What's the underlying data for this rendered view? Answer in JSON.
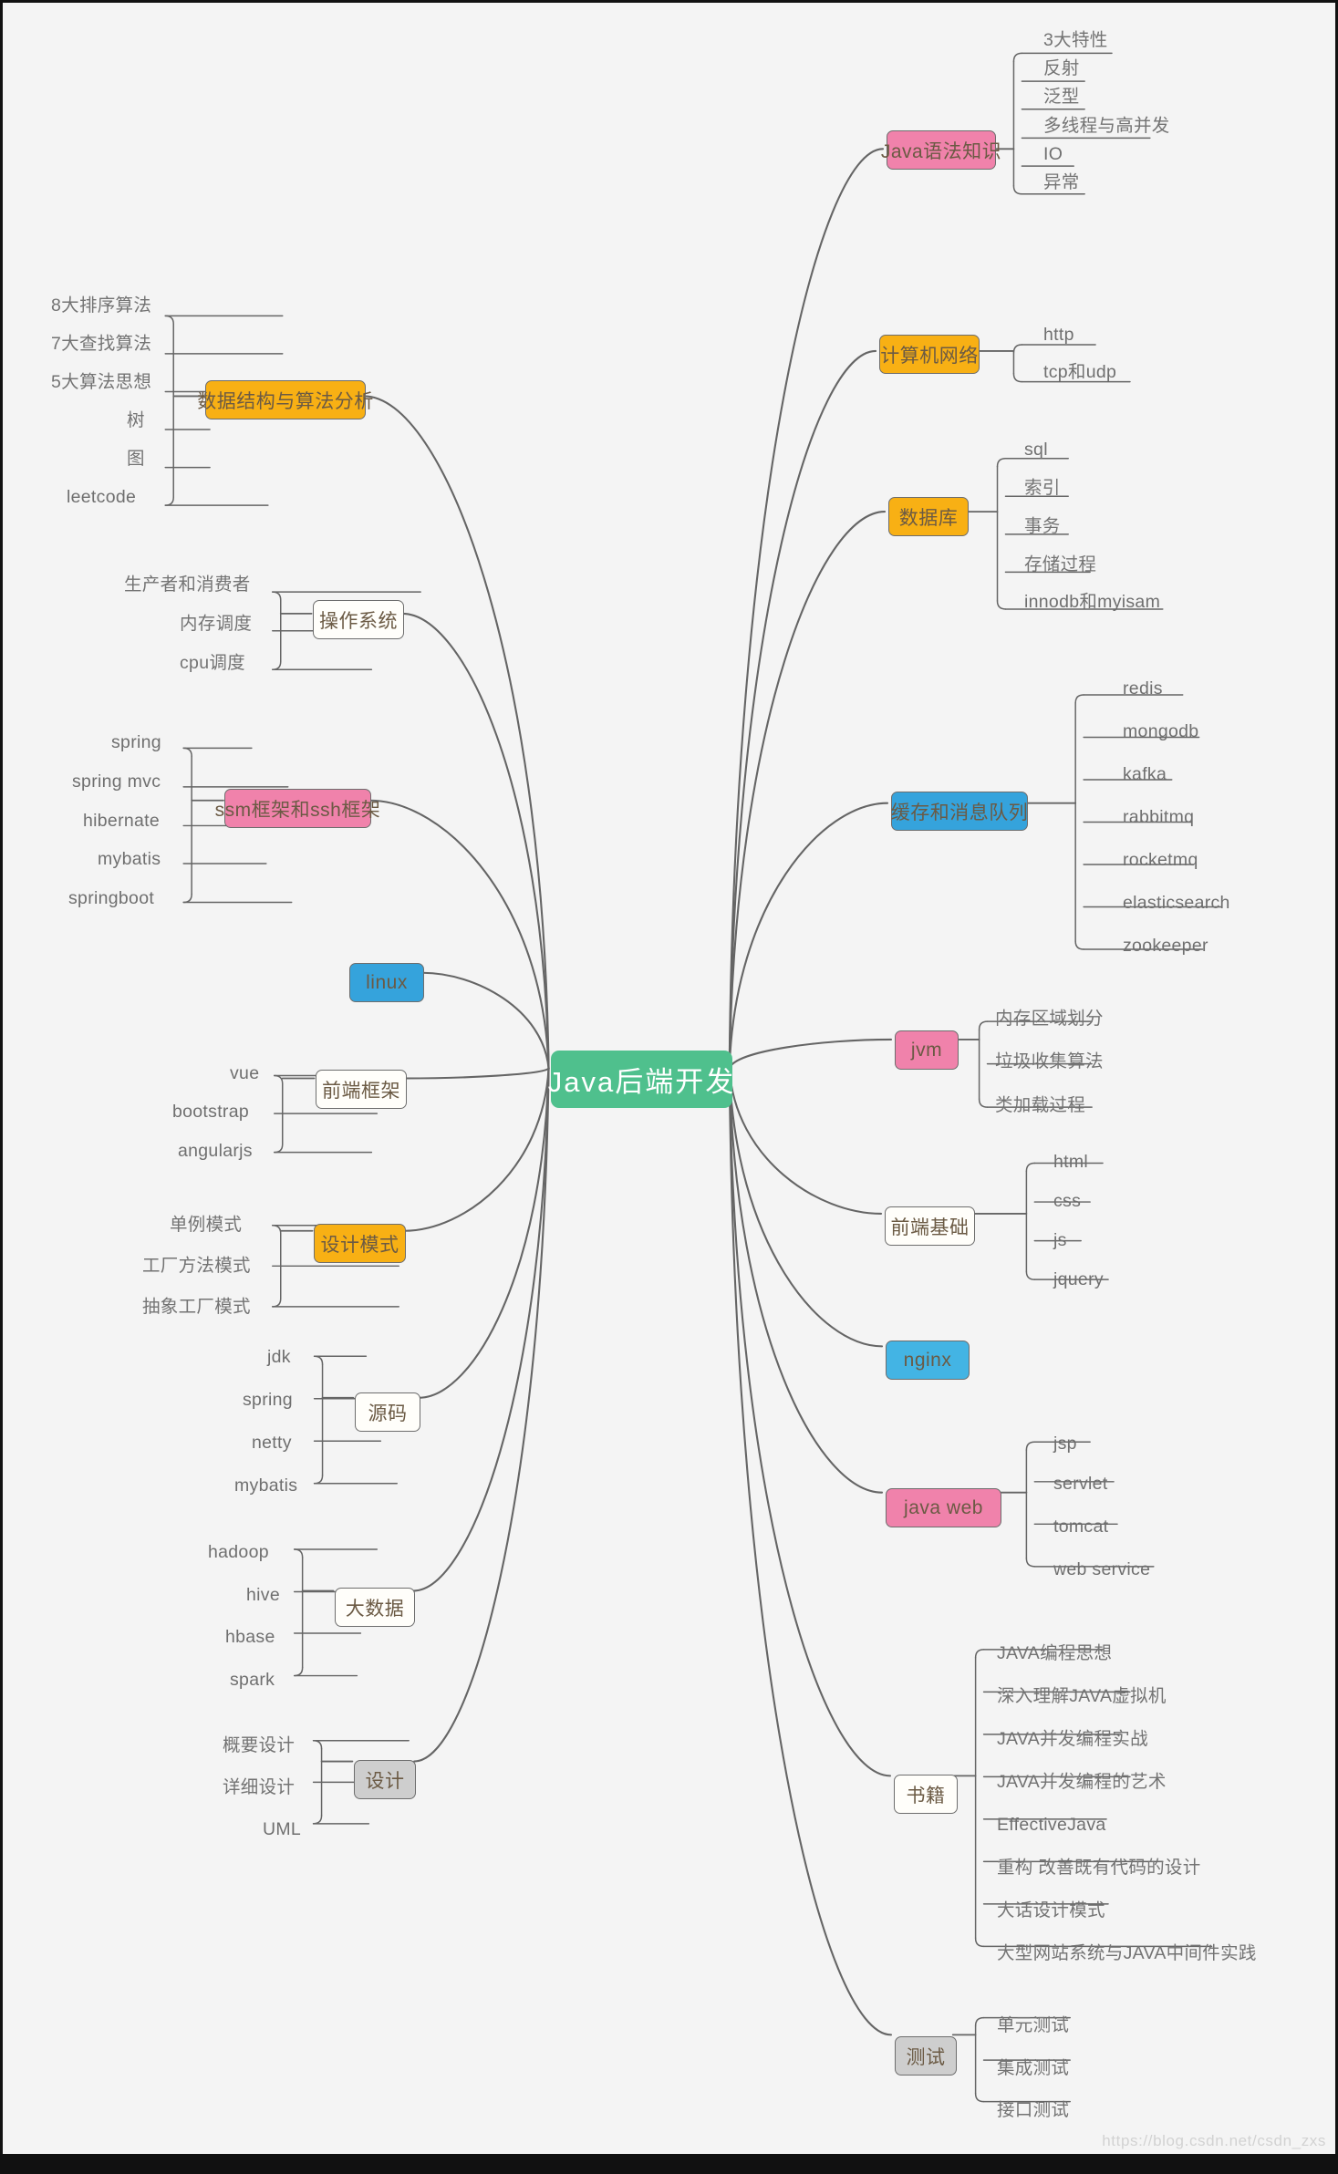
{
  "diagram": {
    "title": "Java后端开发",
    "type": "mindmap",
    "background_color": "#f4f4f4",
    "root_color": "#4fc08d",
    "branch_colors": {
      "pink": "#f082ab",
      "orange": "#f8b014",
      "blue": "#35a3dc",
      "white": "#fffefa",
      "gray": "#cecece"
    },
    "line_color": "#656565",
    "watermark": "https://blog.csdn.net/csdn_zxs"
  },
  "root": {
    "label": "Java后端开发"
  },
  "branches": [
    {
      "id": "java-syntax",
      "label": "Java语法知识",
      "color": "pink",
      "side": "right",
      "children": [
        "3大特性",
        "反射",
        "泛型",
        "多线程与高并发",
        "IO",
        "异常"
      ]
    },
    {
      "id": "computer-network",
      "label": "计算机网络",
      "color": "orange",
      "side": "right",
      "children": [
        "http",
        "tcp和udp"
      ]
    },
    {
      "id": "database",
      "label": "数据库",
      "color": "orange",
      "side": "right",
      "children": [
        "sql",
        "索引",
        "事务",
        "存储过程",
        "innodb和myisam"
      ]
    },
    {
      "id": "cache-mq",
      "label": "缓存和消息队列",
      "color": "blue",
      "side": "right",
      "children": [
        "redis",
        "mongodb",
        "kafka",
        "rabbitmq",
        "rocketmq",
        "elasticsearch",
        "zookeeper"
      ]
    },
    {
      "id": "jvm",
      "label": "jvm",
      "color": "pink",
      "side": "right",
      "children": [
        "内存区域划分",
        "垃圾收集算法",
        "类加载过程"
      ]
    },
    {
      "id": "frontend-basics",
      "label": "前端基础",
      "color": "white",
      "side": "right",
      "children": [
        "html",
        "css",
        "js",
        "jquery"
      ]
    },
    {
      "id": "nginx",
      "label": "nginx",
      "color": "blue",
      "side": "right",
      "children": []
    },
    {
      "id": "java-web",
      "label": "java web",
      "color": "pink",
      "side": "right",
      "children": [
        "jsp",
        "servlet",
        "tomcat",
        "web service"
      ]
    },
    {
      "id": "books",
      "label": "书籍",
      "color": "white",
      "side": "right",
      "children": [
        "JAVA编程思想",
        "深入理解JAVA虚拟机",
        "JAVA并发编程实战",
        "JAVA并发编程的艺术",
        "EffectiveJava",
        "重构 改善既有代码的设计",
        "大话设计模式",
        "大型网站系统与JAVA中间件实践"
      ]
    },
    {
      "id": "testing",
      "label": "测试",
      "color": "gray",
      "side": "right",
      "children": [
        "单元测试",
        "集成测试",
        "接口测试"
      ]
    },
    {
      "id": "data-structure",
      "label": "数据结构与算法分析",
      "color": "orange",
      "side": "left",
      "children": [
        "8大排序算法",
        "7大查找算法",
        "5大算法思想",
        "树",
        "图",
        "leetcode"
      ]
    },
    {
      "id": "operating-system",
      "label": "操作系统",
      "color": "white",
      "side": "left",
      "children": [
        "生产者和消费者",
        "内存调度",
        "cpu调度"
      ]
    },
    {
      "id": "ssm-ssh",
      "label": "ssm框架和ssh框架",
      "color": "pink",
      "side": "left",
      "children": [
        "spring",
        "spring mvc",
        "hibernate",
        "mybatis",
        "springboot"
      ]
    },
    {
      "id": "linux",
      "label": "linux",
      "color": "blue",
      "side": "left",
      "children": []
    },
    {
      "id": "frontend-framework",
      "label": "前端框架",
      "color": "white",
      "side": "left",
      "children": [
        "vue",
        "bootstrap",
        "angularjs"
      ]
    },
    {
      "id": "design-patterns",
      "label": "设计模式",
      "color": "orange",
      "side": "left",
      "children": [
        "单例模式",
        "工厂方法模式",
        "抽象工厂模式"
      ]
    },
    {
      "id": "source-code",
      "label": "源码",
      "color": "white",
      "side": "left",
      "children": [
        "jdk",
        "spring",
        "netty",
        "mybatis"
      ]
    },
    {
      "id": "big-data",
      "label": "大数据",
      "color": "white",
      "side": "left",
      "children": [
        "hadoop",
        "hive",
        "hbase",
        "spark"
      ]
    },
    {
      "id": "design",
      "label": "设计",
      "color": "gray",
      "side": "left",
      "children": [
        "概要设计",
        "详细设计",
        "UML"
      ]
    }
  ]
}
